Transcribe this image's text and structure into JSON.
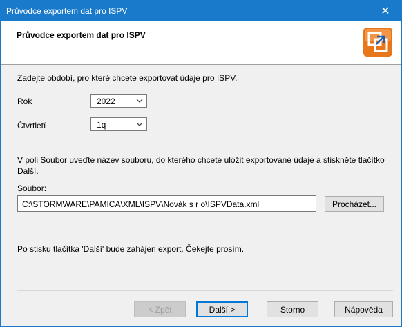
{
  "window": {
    "title": "Průvodce exportem dat pro ISPV",
    "close_glyph": "✕"
  },
  "header": {
    "title": "Průvodce exportem dat pro ISPV",
    "logo_icon": "export-wizard-icon"
  },
  "intro_text": "Zadejte období, pro které chcete exportovat údaje pro ISPV.",
  "fields": {
    "year_label": "Rok",
    "year_value": "2022",
    "quarter_label": "Čtvrtletí",
    "quarter_value": "1q"
  },
  "file_instructions_line1": "V poli Soubor uveďte název souboru, do kterého chcete uložit exportované údaje a stiskněte tlačítko",
  "file_instructions_line2": "Další.",
  "file": {
    "label": "Soubor:",
    "value": "C:\\STORMWARE\\PAMICA\\XML\\ISPV\\Novák s r o\\ISPVData.xml",
    "browse_button": "Procházet..."
  },
  "footer_note": "Po stisku tlačítka 'Další' bude zahájen export. Čekejte prosím.",
  "buttons": {
    "back": "< Zpět",
    "next": "Další >",
    "cancel": "Storno",
    "help": "Nápověda"
  },
  "colors": {
    "titlebar": "#1979ca",
    "accent": "#0078d7"
  }
}
